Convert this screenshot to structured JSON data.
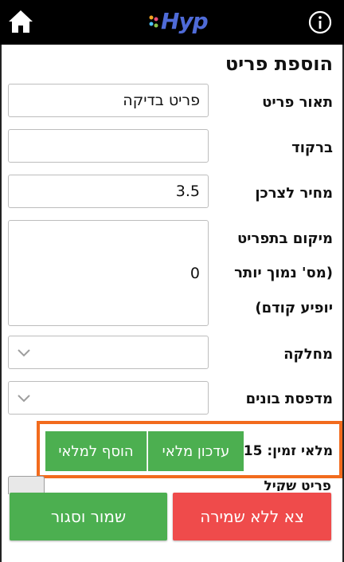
{
  "header": {
    "logo_text": "Hyp",
    "home_icon": "home-icon",
    "info_icon": "info-icon",
    "brand_color": "#4f6bd8"
  },
  "form": {
    "title": "הוספת פריט",
    "description": {
      "label": "תאור פריט",
      "value": "פריט בדיקה"
    },
    "barcode": {
      "label": "ברקוד",
      "value": ""
    },
    "price": {
      "label": "מחיר לצרכן",
      "value": "3.5"
    },
    "menu_position": {
      "label_line1": "מיקום בתפריט",
      "label_line2": "(מס' נמוך יותר",
      "label_line3": "יופיע קודם)",
      "value": "0"
    },
    "category": {
      "label": "מחלקה",
      "value": ""
    },
    "bonus_printer": {
      "label": "מדפסת בונים",
      "value": ""
    },
    "partial_label": "פריט שקיל"
  },
  "inventory": {
    "timer_label": "מלאי זמין:",
    "timer_value": "15",
    "update_button": "עדכון מלאי",
    "add_button": "הוסף למלאי",
    "highlight_color": "#f26b1d"
  },
  "actions": {
    "save_close": "שמור וסגור",
    "exit_no_save": "צא ללא שמירה",
    "save_color": "#4caf50",
    "exit_color": "#ef4b4b"
  }
}
